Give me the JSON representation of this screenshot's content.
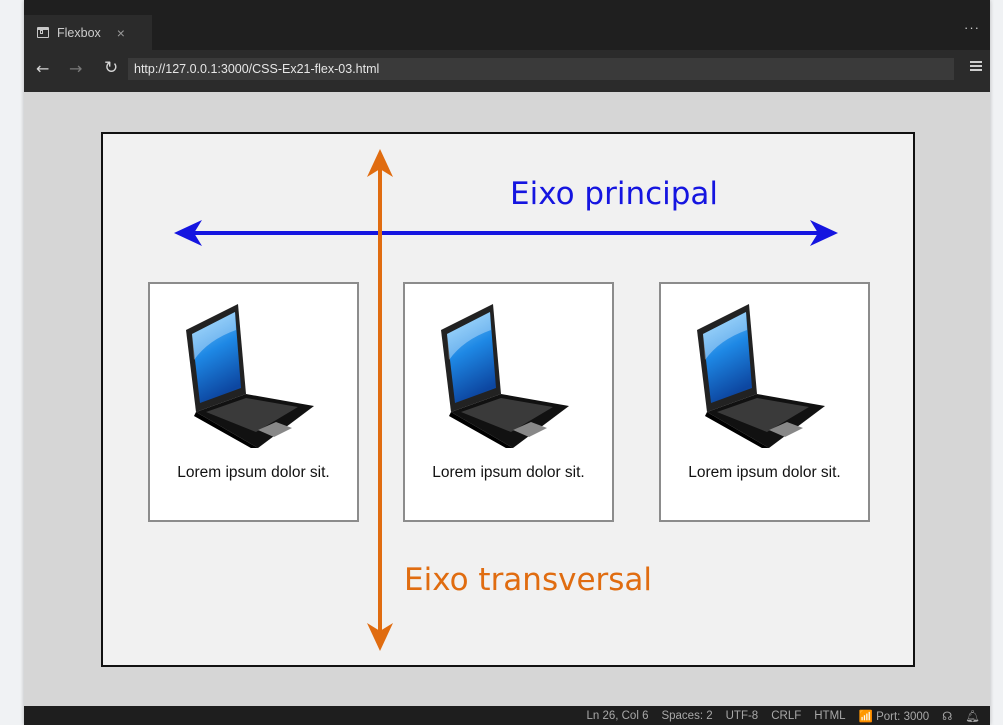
{
  "tab": {
    "title": "Flexbox",
    "close": "×"
  },
  "window_menu": "···",
  "nav": {
    "back": "←",
    "forward": "→",
    "reload": "↻"
  },
  "address": {
    "url": "http://127.0.0.1:3000/CSS-Ex21-flex-03.html"
  },
  "page": {
    "items": [
      {
        "text": "Lorem ipsum dolor sit."
      },
      {
        "text": "Lorem ipsum dolor sit."
      },
      {
        "text": "Lorem ipsum dolor sit."
      }
    ],
    "main_axis_label": "Eixo principal",
    "cross_axis_label": "Eixo transversal",
    "main_axis_color": "#1515e0",
    "cross_axis_color": "#e06c10"
  },
  "status": {
    "position": "Ln 26, Col 6",
    "spaces": "Spaces: 2",
    "encoding": "UTF-8",
    "eol": "CRLF",
    "language": "HTML",
    "port": "Port: 3000"
  }
}
